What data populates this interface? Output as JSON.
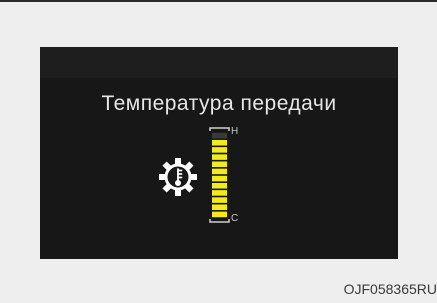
{
  "display": {
    "title": "Температура передачи",
    "icon": "transmission-temperature-gear-icon",
    "gauge": {
      "hot_label": "H",
      "cold_label": "C",
      "level_fraction": 0.92,
      "segments": 12,
      "fill_color": "#f2ea1a"
    }
  },
  "caption": "OJF058365RU"
}
